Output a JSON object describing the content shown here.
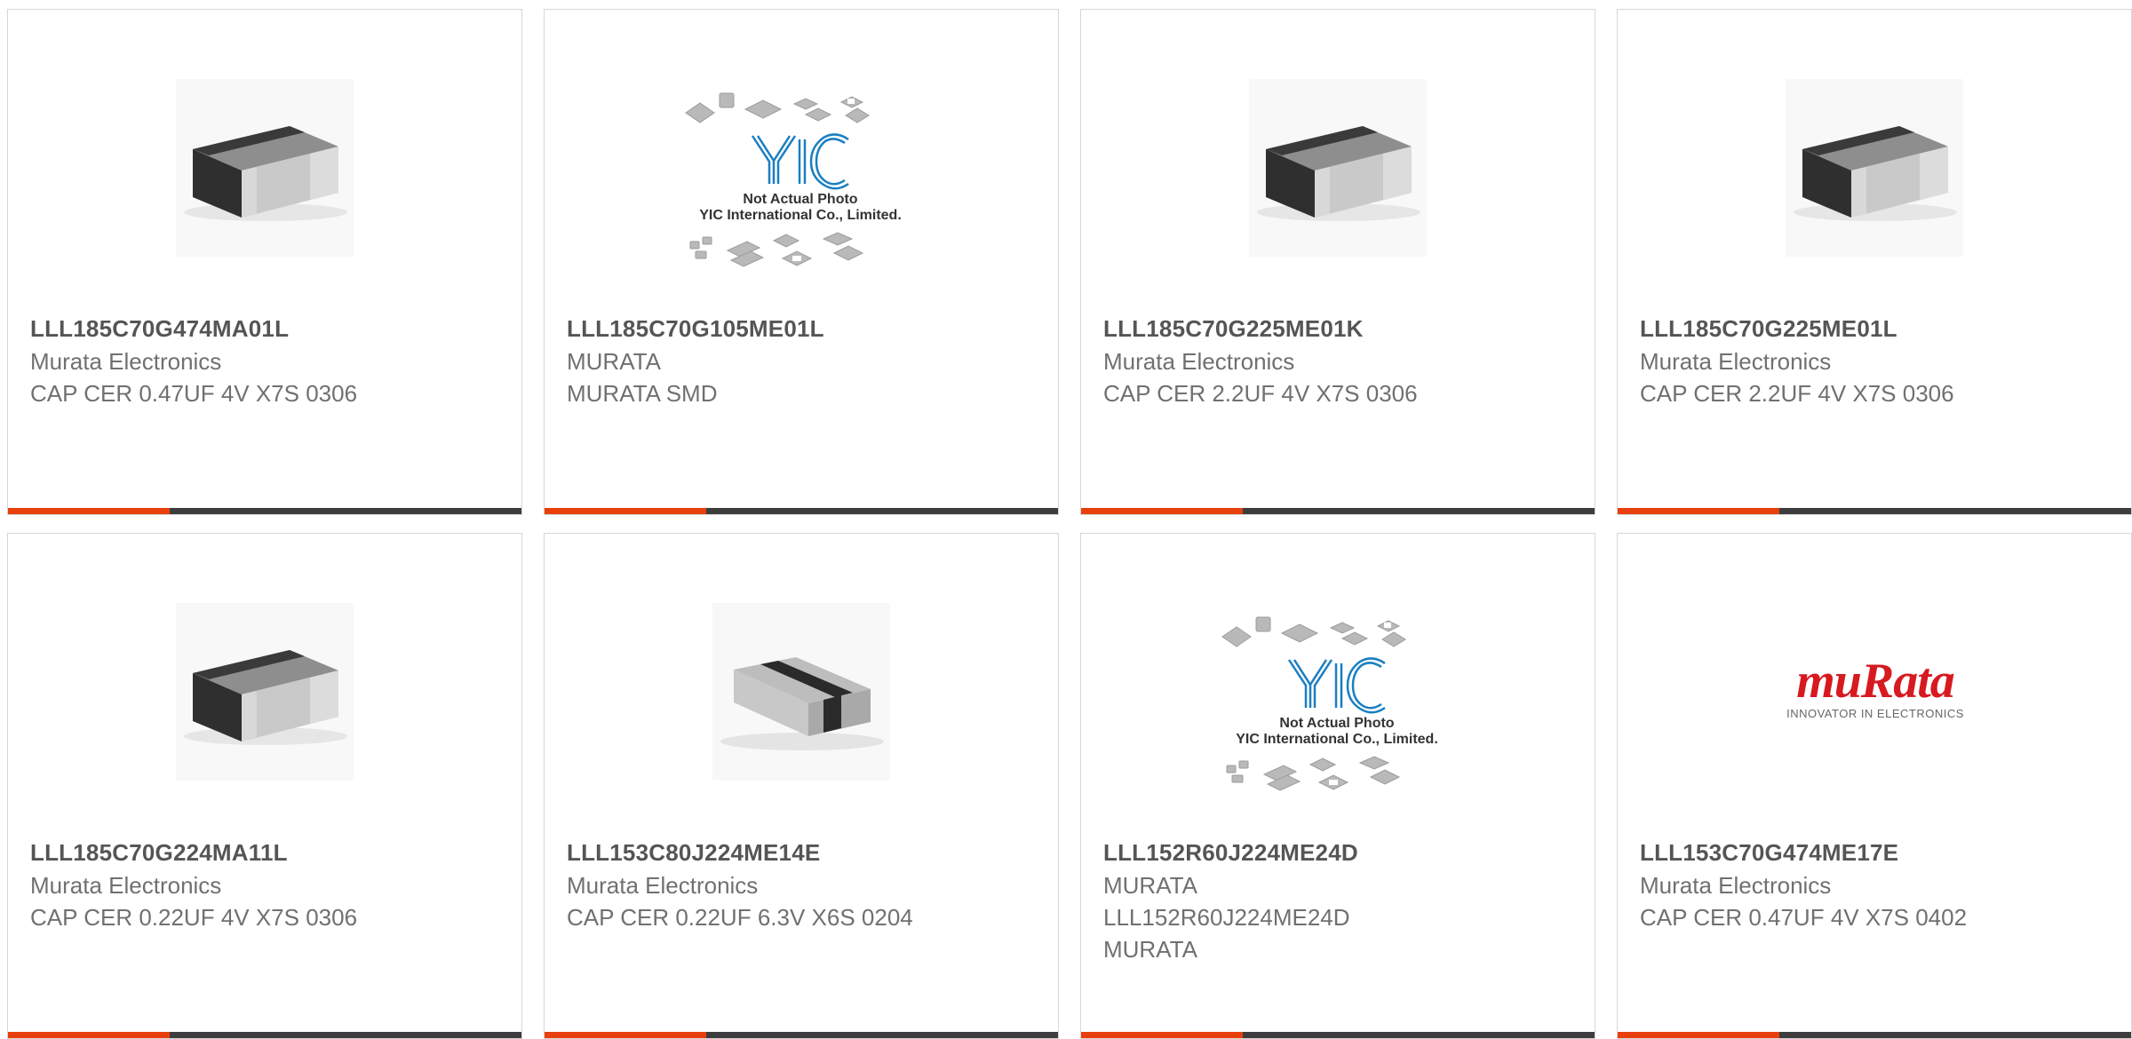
{
  "products": [
    {
      "image": "chip-capacitor-photo",
      "part_number": "LLL185C70G474MA01L",
      "lines": [
        "Murata Electronics",
        "CAP CER 0.47UF 4V X7S 0306"
      ]
    },
    {
      "image": "yic-placeholder-photo",
      "part_number": "LLL185C70G105ME01L",
      "lines": [
        "MURATA",
        "MURATA SMD"
      ]
    },
    {
      "image": "chip-capacitor-photo",
      "part_number": "LLL185C70G225ME01K",
      "lines": [
        "Murata Electronics",
        "CAP CER 2.2UF 4V X7S 0306"
      ]
    },
    {
      "image": "chip-capacitor-photo",
      "part_number": "LLL185C70G225ME01L",
      "lines": [
        "Murata Electronics",
        "CAP CER 2.2UF 4V X7S 0306"
      ]
    },
    {
      "image": "chip-capacitor-photo",
      "part_number": "LLL185C70G224MA11L",
      "lines": [
        "Murata Electronics",
        "CAP CER 0.22UF 4V X7S 0306"
      ]
    },
    {
      "image": "chip-capacitor-striped-photo",
      "part_number": "LLL153C80J224ME14E",
      "lines": [
        "Murata Electronics",
        "CAP CER 0.22UF 6.3V X6S 0204"
      ]
    },
    {
      "image": "yic-placeholder-photo",
      "part_number": "LLL152R60J224ME24D",
      "lines": [
        "MURATA",
        "LLL152R60J224ME24D",
        "MURATA"
      ]
    },
    {
      "image": "murata-logo",
      "part_number": "LLL153C70G474ME17E",
      "lines": [
        "Murata Electronics",
        "CAP CER 0.47UF 4V X7S 0402"
      ]
    }
  ],
  "yic_placeholder": {
    "brand": "YIC",
    "caption_line1": "Not Actual Photo",
    "caption_line2": "YIC International Co., Limited."
  },
  "murata_logo": {
    "wordmark": "muRata",
    "tagline": "INNOVATOR IN ELECTRONICS"
  },
  "colors": {
    "accent": "#e8400c",
    "bar": "#3d3d3d",
    "border": "#d7d7d7",
    "murata_red": "#d71920",
    "yic_blue": "#1a7fc1"
  }
}
